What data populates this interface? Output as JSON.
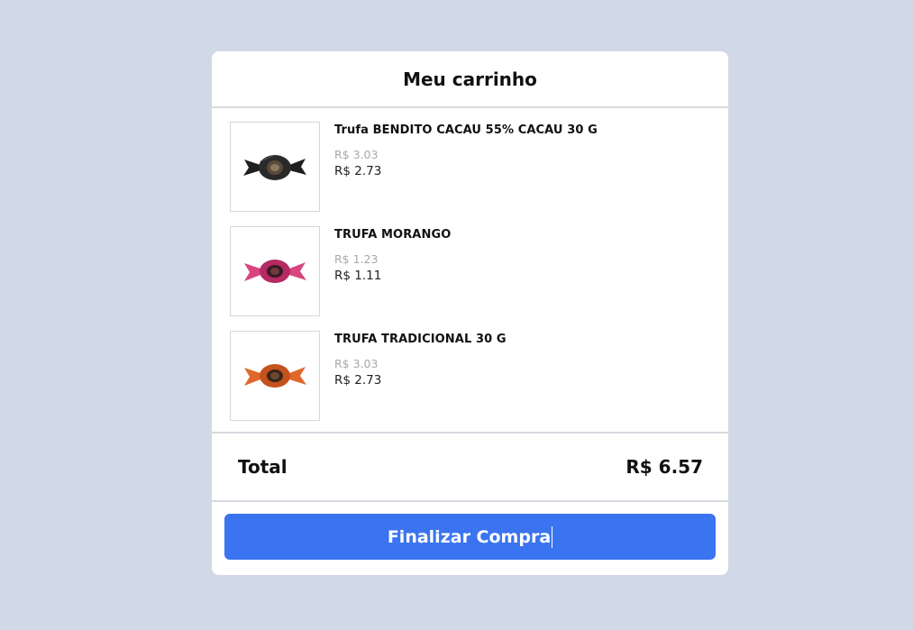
{
  "cart": {
    "title": "Meu carrinho",
    "items": [
      {
        "name": "Trufa BENDITO CACAU 55% CACAU 30 G",
        "old_price": "R$ 3.03",
        "price": "R$ 2.73",
        "icon": "truffle-dark-image",
        "wrapper_color": "#2b2b2b"
      },
      {
        "name": "TRUFA MORANGO",
        "old_price": "R$ 1.23",
        "price": "R$ 1.11",
        "icon": "truffle-strawberry-image",
        "wrapper_color": "#c8336f"
      },
      {
        "name": "TRUFA TRADICIONAL 30 G",
        "old_price": "R$ 3.03",
        "price": "R$ 2.73",
        "icon": "truffle-traditional-image",
        "wrapper_color": "#d2571f"
      }
    ],
    "total_label": "Total",
    "total_value": "R$ 6.57",
    "checkout_label": "Finalizar Compra"
  },
  "colors": {
    "background": "#d2d9e6",
    "accent": "#3b74f0"
  }
}
